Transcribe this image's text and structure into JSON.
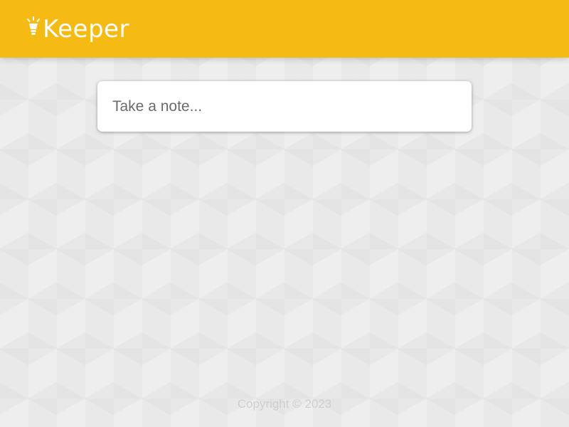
{
  "header": {
    "title": "Keeper",
    "logo_icon": "lightbulb-icon",
    "background_color": "#f5ba13"
  },
  "note_form": {
    "placeholder": "Take a note..."
  },
  "footer": {
    "copyright": "Copyright © 2023"
  }
}
